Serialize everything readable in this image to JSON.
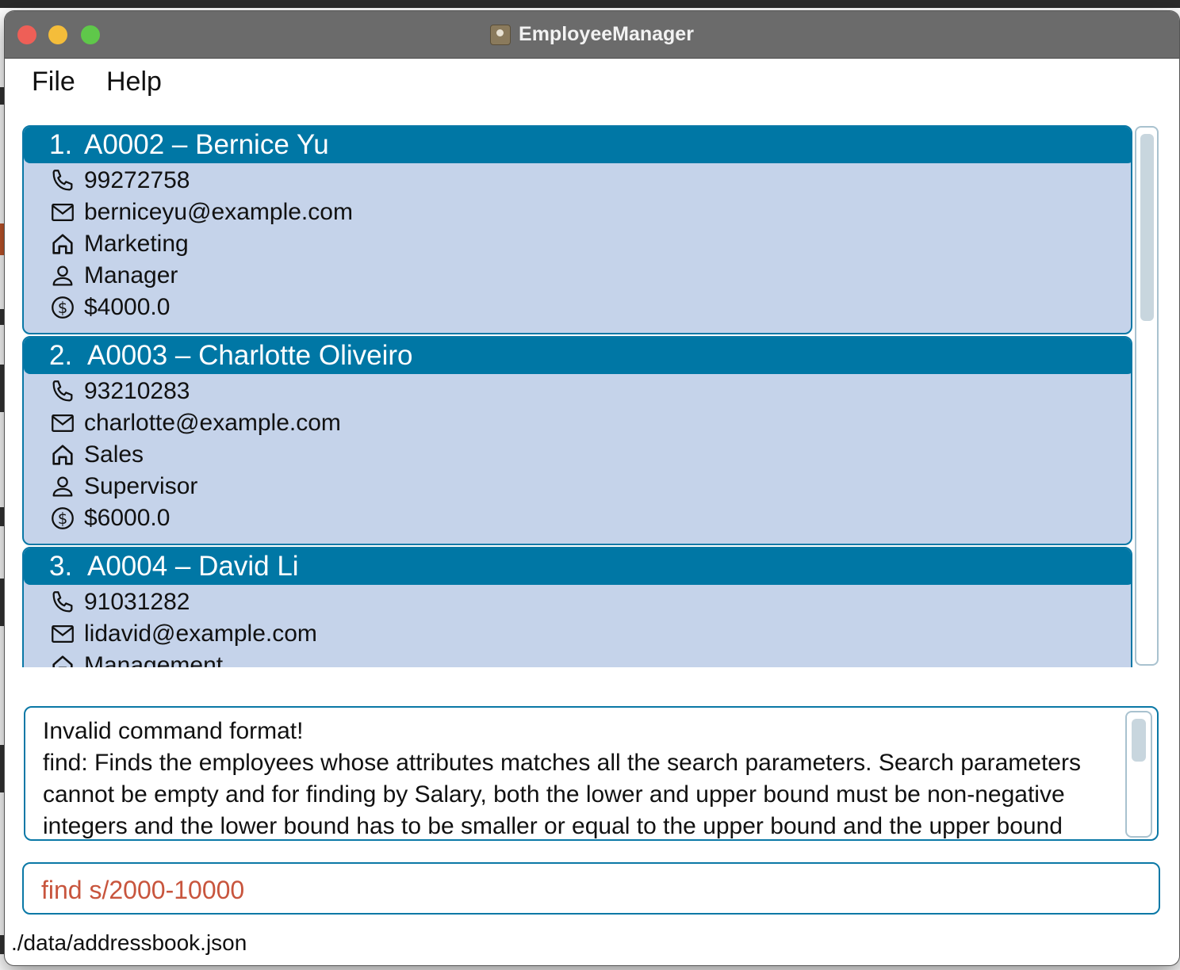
{
  "window": {
    "title": "EmployeeManager"
  },
  "menu": {
    "file": "File",
    "help": "Help"
  },
  "employees": [
    {
      "index": "1.",
      "title": "A0002 – Bernice Yu",
      "phone": "99272758",
      "email": "berniceyu@example.com",
      "department": "Marketing",
      "role": "Manager",
      "salary": "$4000.0"
    },
    {
      "index": "2.",
      "title": "A0003 – Charlotte Oliveiro",
      "phone": "93210283",
      "email": "charlotte@example.com",
      "department": "Sales",
      "role": "Supervisor",
      "salary": "$6000.0"
    },
    {
      "index": "3.",
      "title": "A0004 – David Li",
      "phone": "91031282",
      "email": "lidavid@example.com",
      "department": "Management",
      "role": "",
      "salary": ""
    }
  ],
  "result": {
    "text": "Invalid command format!\nfind: Finds the employees whose attributes matches all the search parameters. Search parameters cannot be empty and for finding by Salary, both the lower and upper bound must be non-negative integers and the lower bound has to be smaller or equal to the upper bound and the upper bound"
  },
  "command": {
    "value": "find s/2000-10000"
  },
  "status": {
    "path": "./data/addressbook.json"
  },
  "colors": {
    "header": "#0077a5",
    "card_bg": "#c5d3ea",
    "command_text": "#c8553d"
  },
  "icons": {
    "phone": "phone-icon",
    "email": "mail-icon",
    "department": "home-icon",
    "role": "person-icon",
    "salary": "dollar-icon"
  }
}
